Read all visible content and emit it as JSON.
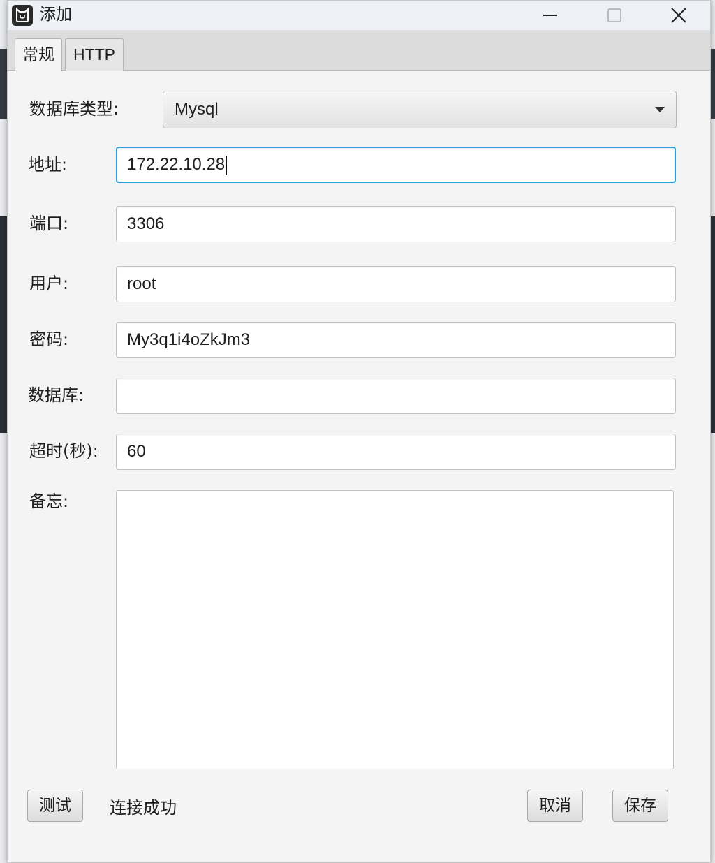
{
  "window": {
    "title": "添加"
  },
  "tabs": [
    {
      "label": "常规"
    },
    {
      "label": "HTTP"
    }
  ],
  "form": {
    "db_type": {
      "label": "数据库类型:",
      "value": "Mysql"
    },
    "address": {
      "label": "地址:",
      "value": "172.22.10.28"
    },
    "port": {
      "label": "端口:",
      "value": "3306"
    },
    "user": {
      "label": "用户:",
      "value": "root"
    },
    "password": {
      "label": "密码:",
      "value": "My3q1i4oZkJm3"
    },
    "database": {
      "label": "数据库:",
      "value": ""
    },
    "timeout": {
      "label": "超时(秒):",
      "value": "60"
    },
    "memo": {
      "label": "备忘:",
      "value": ""
    }
  },
  "footer": {
    "test_label": "测试",
    "status_text": "连接成功",
    "cancel_label": "取消",
    "save_label": "保存"
  },
  "colors": {
    "focus_border": "#2d9fd8",
    "dialog_bg": "#f4f4f4"
  },
  "icons": {
    "app": "app-cat-icon",
    "minimize": "minimize-icon",
    "maximize": "maximize-icon",
    "close": "close-icon",
    "dropdown": "chevron-down-icon"
  }
}
